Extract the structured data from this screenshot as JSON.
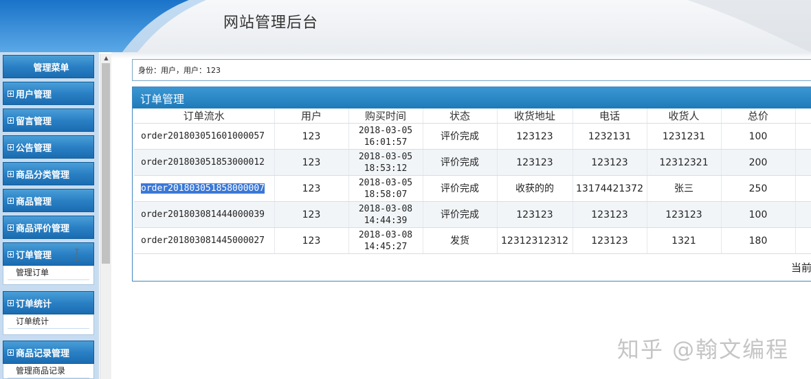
{
  "header": {
    "title": "网站管理后台"
  },
  "menu": {
    "title": "管理菜单",
    "sections": [
      {
        "label": "用户管理",
        "items": []
      },
      {
        "label": "留言管理",
        "items": []
      },
      {
        "label": "公告管理",
        "items": []
      },
      {
        "label": "商品分类管理",
        "items": []
      },
      {
        "label": "商品管理",
        "items": []
      },
      {
        "label": "商品评价管理",
        "items": []
      },
      {
        "label": "订单管理",
        "items": [
          "管理订单"
        ]
      },
      {
        "label": "订单统计",
        "items": [
          "订单统计"
        ]
      },
      {
        "label": "商品记录管理",
        "items": [
          "管理商品记录"
        ]
      }
    ]
  },
  "identity": "身份：用户，用户：123",
  "panel": {
    "title": "订单管理",
    "columns": [
      "订单流水",
      "用户",
      "购买时间",
      "状态",
      "收货地址",
      "电话",
      "收货人",
      "总价",
      ""
    ],
    "rows": [
      {
        "order_no": "order201803051601000057",
        "user": "123",
        "date": "2018-03-05",
        "time": "16:01:57",
        "status": "评价完成",
        "address": "123123",
        "phone": "1232131",
        "receiver": "1231231",
        "total": "100"
      },
      {
        "order_no": "order201803051853000012",
        "user": "123",
        "date": "2018-03-05",
        "time": "18:53:12",
        "status": "评价完成",
        "address": "123123",
        "phone": "123123",
        "receiver": "12312321",
        "total": "200"
      },
      {
        "order_no": "order201803051858000007",
        "user": "123",
        "date": "2018-03-05",
        "time": "18:58:07",
        "status": "评价完成",
        "address": "收获的的",
        "phone": "13174421372",
        "receiver": "张三",
        "total": "250"
      },
      {
        "order_no": "order201803081444000039",
        "user": "123",
        "date": "2018-03-08",
        "time": "14:44:39",
        "status": "评价完成",
        "address": "123123",
        "phone": "123123",
        "receiver": "123123",
        "total": "100"
      },
      {
        "order_no": "order201803081445000027",
        "user": "123",
        "date": "2018-03-08",
        "time": "14:45:27",
        "status": "发货",
        "address": "12312312312",
        "phone": "123123",
        "receiver": "1321",
        "total": "180"
      }
    ],
    "pager": "当前"
  },
  "watermark": "知乎 @翰文编程",
  "colors": {
    "accent": "#1f7ab9",
    "selection": "#3a78d6"
  }
}
